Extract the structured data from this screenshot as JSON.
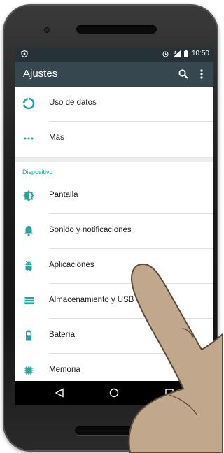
{
  "statusbar": {
    "time": "10:50"
  },
  "appbar": {
    "title": "Ajustes",
    "icons": [
      "search-icon",
      "more-vert-icon"
    ]
  },
  "sections": {
    "top_items": [
      {
        "label": "Uso de datos",
        "icon": "data-usage-icon"
      },
      {
        "label": "Más",
        "icon": "more-horiz-icon"
      }
    ],
    "dispositivo_header": "Dispositivo",
    "dispositivo_items": [
      {
        "label": "Pantalla",
        "icon": "brightness-icon"
      },
      {
        "label": "Sonido y notificaciones",
        "icon": "bell-icon"
      },
      {
        "label": "Aplicaciones",
        "icon": "android-icon"
      },
      {
        "label": "Almacenamiento y USB",
        "icon": "storage-icon"
      },
      {
        "label": "Batería",
        "icon": "battery-icon"
      },
      {
        "label": "Memoria",
        "icon": "memory-icon"
      }
    ]
  },
  "colors": {
    "accent": "#26a69a",
    "appbar": "#37474f",
    "statusbar": "#263238"
  },
  "navbar": {
    "icons": [
      "back-icon",
      "home-icon",
      "recents-icon"
    ]
  }
}
